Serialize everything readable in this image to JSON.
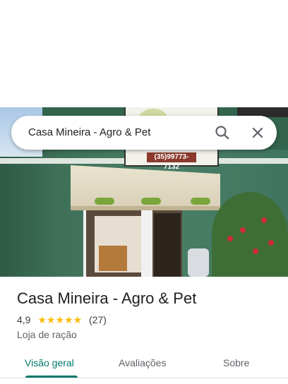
{
  "search": {
    "query": "Casa Mineira - Agro & Pet",
    "search_icon": "search-icon",
    "close_icon": "close-icon"
  },
  "photo": {
    "sign_phone": "(35)99773-7132"
  },
  "place": {
    "title": "Casa Mineira - Agro & Pet",
    "rating": "4,9",
    "stars": 5,
    "stars_glyph": "★★★★★",
    "review_count": "(27)",
    "category": "Loja de ração"
  },
  "tabs": [
    {
      "label": "Visão geral",
      "active": true
    },
    {
      "label": "Avaliações",
      "active": false
    },
    {
      "label": "Sobre",
      "active": false
    }
  ],
  "colors": {
    "accent": "#00796b",
    "star": "#fbbc04",
    "text_primary": "#202124",
    "text_secondary": "#5f6368"
  }
}
